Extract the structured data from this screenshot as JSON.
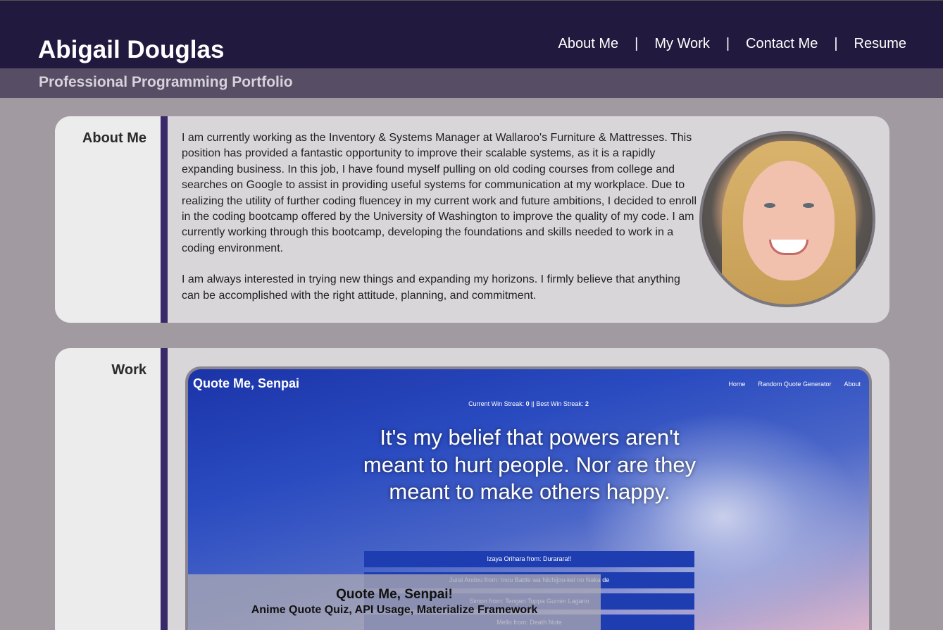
{
  "header": {
    "title": "Abigail Douglas",
    "subtitle": "Professional Programming Portfolio",
    "nav": [
      {
        "label": "About Me"
      },
      {
        "label": "My Work"
      },
      {
        "label": "Contact Me"
      },
      {
        "label": "Resume"
      }
    ],
    "separator": "|"
  },
  "about": {
    "label": "About Me",
    "paragraphs": [
      "I am currently working as the Inventory & Systems Manager at Wallaroo's Furniture & Mattresses. This position has provided a fantastic opportunity to improve their scalable systems, as it is a rapidly expanding business. In this job, I have found myself pulling on old coding courses from college and searches on Google to assist in providing useful systems for communication at my workplace. Due to realizing the utility of further coding fluencey in my current work and future ambitions, I decided to enroll in the coding bootcamp offered by the University of Washington to improve the quality of my code. I am currently working through this bootcamp, developing the foundations and skills needed to work in a coding environment.",
      "I am always interested in trying new things and expanding my horizons. I firmly believe that anything can be accomplished with the right attitude, planning, and commitment."
    ]
  },
  "work": {
    "label": "Work",
    "project": {
      "title": "Quote Me, Senpai!",
      "tags": "Anime Quote Quiz, API Usage, Materialize Framework",
      "screenshot": {
        "brand": "Quote Me, Senpai",
        "nav": [
          "Home",
          "Random Quote Generator",
          "About"
        ],
        "streak_prefix": "Current Win Streak: ",
        "streak_current": "0",
        "streak_mid": " || Best Win Streak: ",
        "streak_best": "2",
        "quote": "It's my belief that powers aren't meant to hurt people. Nor are they meant to make others happy.",
        "options": [
          "Izaya Orihara from: Durarara!!",
          "Jurai Andou from: Inou Battle wa Nichijou-kei no Naka de",
          "Simon from: Tengen Toppa Gurren Lagann",
          "Mello from: Death Note"
        ]
      }
    }
  },
  "colors": {
    "header_bg": "#21193e",
    "subheader_bg": "#574e66",
    "page_bg": "#a19ba1",
    "accent_bar": "#3a2a6a"
  }
}
